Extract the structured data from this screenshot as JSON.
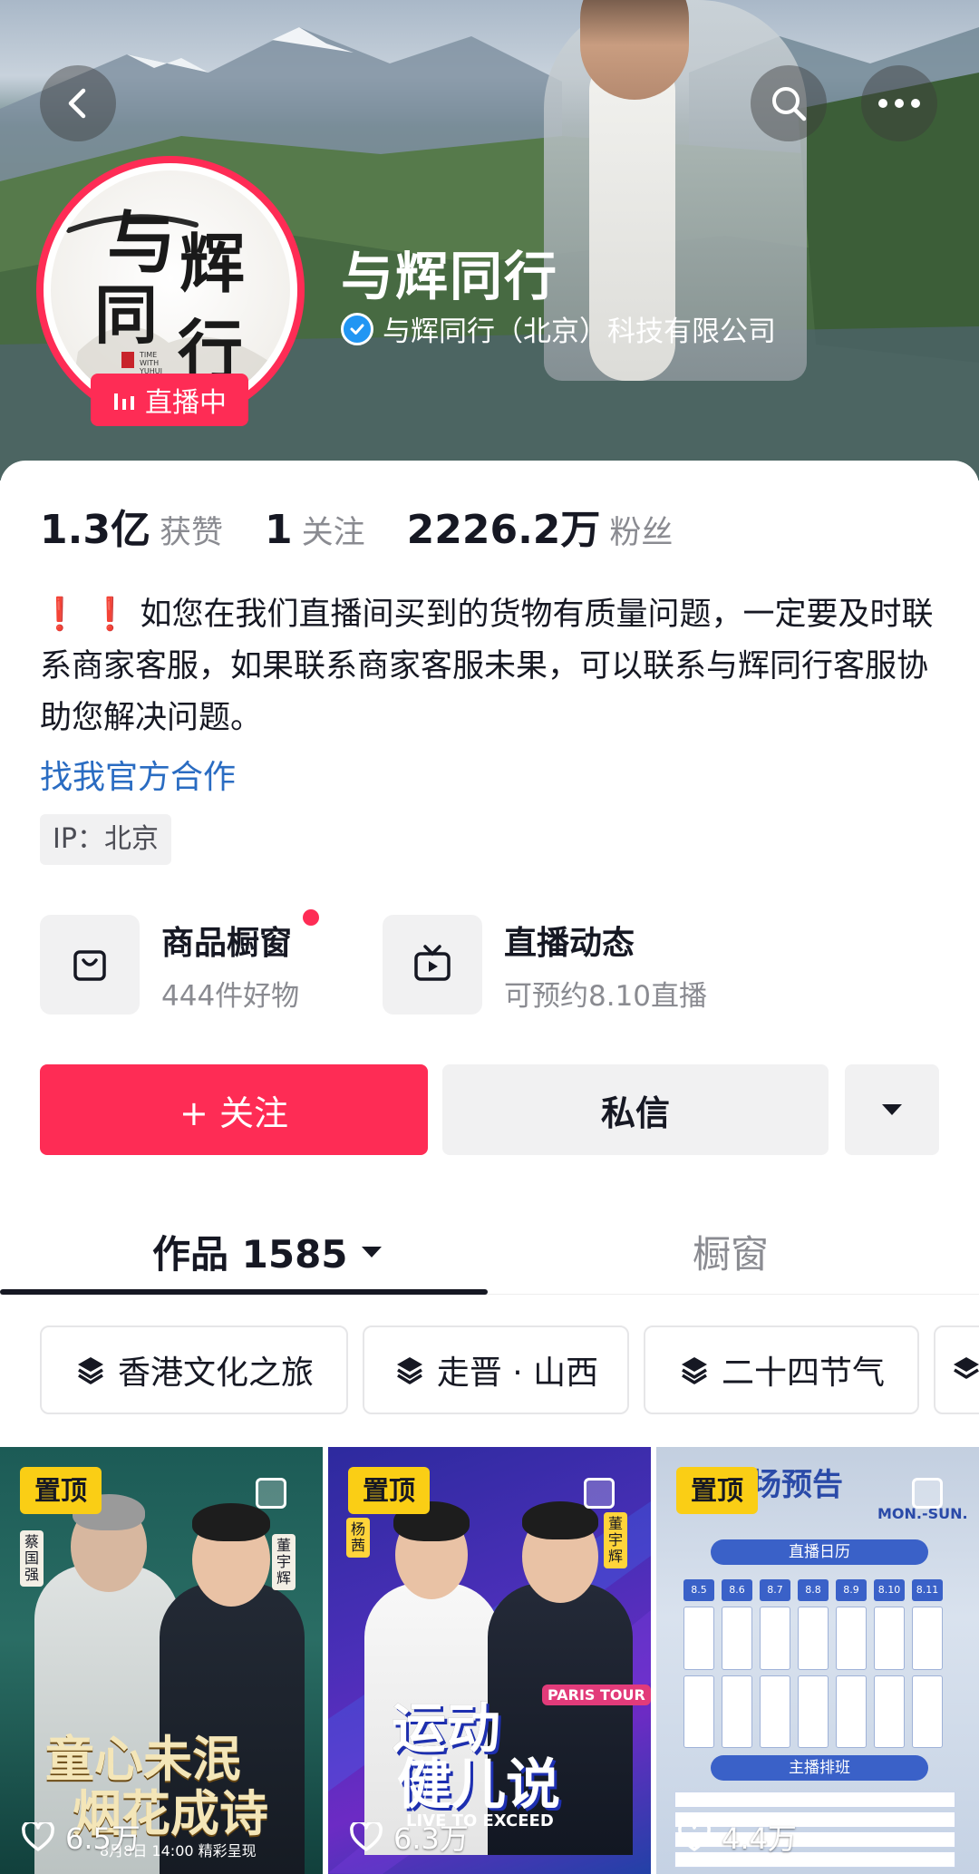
{
  "header": {
    "name": "与辉同行",
    "verified_label": "与辉同行（北京）科技有限公司",
    "live_badge": "直播中",
    "avatar_text": {
      "line1": "与",
      "line2": "辉",
      "line3": "同",
      "line4": "行",
      "english": "TIME WITH YUHUI"
    }
  },
  "stats": [
    {
      "value": "1.3亿",
      "label": "获赞"
    },
    {
      "value": "1",
      "label": "关注"
    },
    {
      "value": "2226.2万",
      "label": "粉丝"
    }
  ],
  "bio": {
    "marks": "❗ ❗",
    "text": "如您在我们直播间买到的货物有质量问题，一定要及时联系商家客服，如果联系商家客服未果，可以联系与辉同行客服协助您解决问题。",
    "link": "找我官方合作",
    "ip": "IP：北京"
  },
  "entries": {
    "shop": {
      "title": "商品橱窗",
      "subtitle": "444件好物"
    },
    "live": {
      "title": "直播动态",
      "subtitle": "可预约8.10直播"
    }
  },
  "actions": {
    "follow": "+ 关注",
    "message": "私信"
  },
  "tabs": {
    "works_label": "作品 1585",
    "shop_label": "橱窗"
  },
  "collections": [
    "香港文化之旅",
    "走晋 · 山西",
    "二十四节气"
  ],
  "videos": [
    {
      "pinned": "置顶",
      "likes": "6.5万",
      "poster_title_1": "童心未泯",
      "poster_title_2": "烟花成诗",
      "poster_date": "8月8日 14:00 精彩呈现",
      "name_a": "蔡国强",
      "name_b": "董宇辉"
    },
    {
      "pinned": "置顶",
      "likes": "6.3万",
      "poster_title_1": "运动",
      "poster_title_2": "健儿说",
      "poster_tag": "PARIS TOUR",
      "poster_sub": "LIVE TO EXCEED",
      "name_a": "杨茜",
      "name_b": "董宇辉"
    },
    {
      "pinned": "置顶",
      "likes": "4.4万",
      "poster_title": "专场预告",
      "poster_range": "MON.-SUN.",
      "band_1": "直播日历",
      "band_2": "主播排班",
      "dates": [
        "8.5",
        "8.6",
        "8.7",
        "8.8",
        "8.9",
        "8.10",
        "8.11"
      ]
    }
  ],
  "colors": {
    "accent": "#fe2c55",
    "link": "#2a6cc2",
    "pin": "#face15",
    "verify": "#2196f3"
  }
}
